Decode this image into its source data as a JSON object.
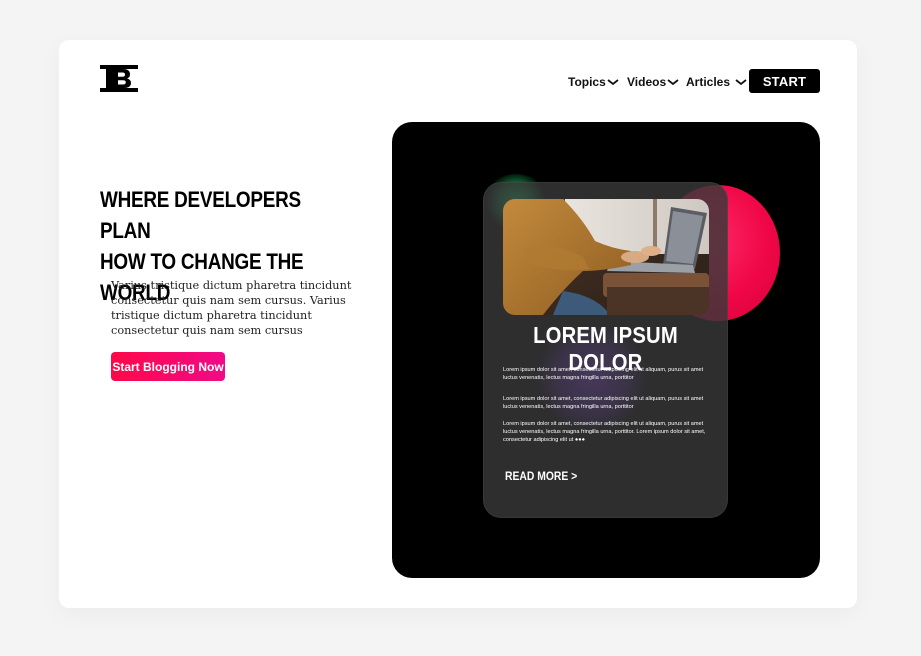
{
  "header": {
    "logo_icon": "bold-b-logo-icon",
    "nav": [
      {
        "label": "Topics",
        "icon": "chevron-down-icon"
      },
      {
        "label": "Videos",
        "icon": "chevron-down-icon"
      },
      {
        "label": "Articles",
        "icon": "chevron-down-icon"
      }
    ],
    "start_label": "START"
  },
  "hero": {
    "title_line1": "WHERE DEVELOPERS PLAN",
    "title_line2": "HOW TO CHANGE THE WORLD",
    "description": "Varius tristique dictum pharetra tincidunt consectetur quis nam sem cursus. Varius tristique dictum pharetra tincidunt consectetur quis nam sem cursus",
    "cta_label": "Start Blogging Now"
  },
  "feature_card": {
    "title": "LOREM IPSUM DOLOR",
    "paragraphs": [
      "Lorem ipsum dolor sit amet, consectetur adipiscing elit ut aliquam, purus sit amet luctus venenatis, lectus magna fringilla urna, porttitor",
      "Lorem ipsum dolor sit amet, consectetur adipiscing elit ut aliquam, purus sit amet luctus venenatis, lectus magna fringilla urna, porttitor",
      "Lorem ipsum dolor sit amet, consectetur adipiscing elit ut aliquam, purus sit amet luctus venenatis, lectus magna fringilla urna, porttitor. Lorem ipsum dolor sit amet, consectetur adipiscing elit ut ●●●"
    ],
    "read_more_label": "READ MORE >",
    "image_icon": "laptop-typing-photo"
  },
  "colors": {
    "accent_pink": "#ff0848",
    "accent_magenta": "#f00a86",
    "panel_bg": "#000000",
    "glow_green": "#21e27a",
    "glow_purple": "#8b3cff"
  }
}
